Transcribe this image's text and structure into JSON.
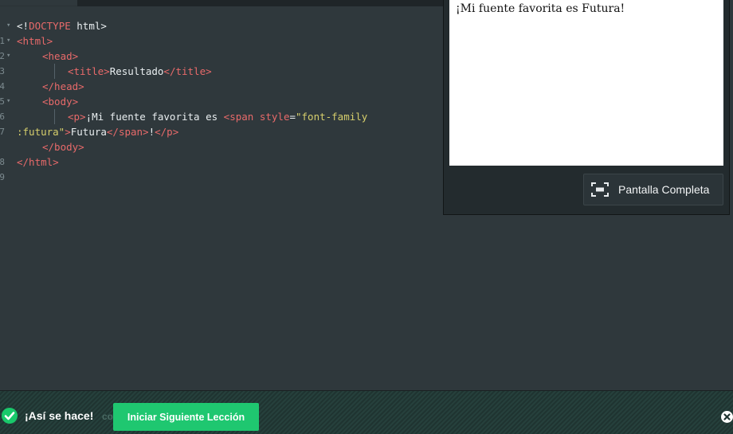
{
  "editor": {
    "lines": [
      {
        "n": "1",
        "fold": "▾"
      },
      {
        "n": "2",
        "fold": "▾"
      },
      {
        "n": "3",
        "fold": "▾"
      },
      {
        "n": "4",
        "fold": ""
      },
      {
        "n": "5",
        "fold": ""
      },
      {
        "n": "6",
        "fold": "▾"
      },
      {
        "n": "7",
        "fold": ""
      },
      {
        "n": "",
        "fold": ""
      },
      {
        "n": "8",
        "fold": ""
      },
      {
        "n": "9",
        "fold": ""
      }
    ],
    "tokens": {
      "doctype_open": "<!",
      "doctype_kw": "DOCTYPE",
      "doctype_rest": " html>",
      "html_open": "<html>",
      "head_open": "<head>",
      "title_open": "<title>",
      "title_text": "Resultado",
      "title_close": "</title>",
      "head_close": "</head>",
      "body_open": "<body>",
      "p_open": "<p>",
      "p_text": "¡Mi fuente favorita es ",
      "span_open": "<span",
      "style_attr": " style",
      "equals": "=",
      "style_val_1": "\"font-family",
      "style_val_2": ":futura\"",
      "span_gt": ">",
      "span_text": "Futura",
      "span_close": "</span>",
      "excl": "!",
      "p_close": "</p>",
      "body_close": "</body>",
      "html_close": "</html>"
    }
  },
  "preview": {
    "text": "¡Mi fuente favorita es Futura!",
    "fullscreen_label": "Pantalla Completa",
    "fullscreen_icon": "fullscreen-icon"
  },
  "footer": {
    "done_label": "¡Así se hace!",
    "ghost_text": "co",
    "next_label": "Iniciar Siguiente Lección",
    "check_icon": "check-circle-icon",
    "close_icon": "close-icon",
    "accent": "#1fc770"
  }
}
